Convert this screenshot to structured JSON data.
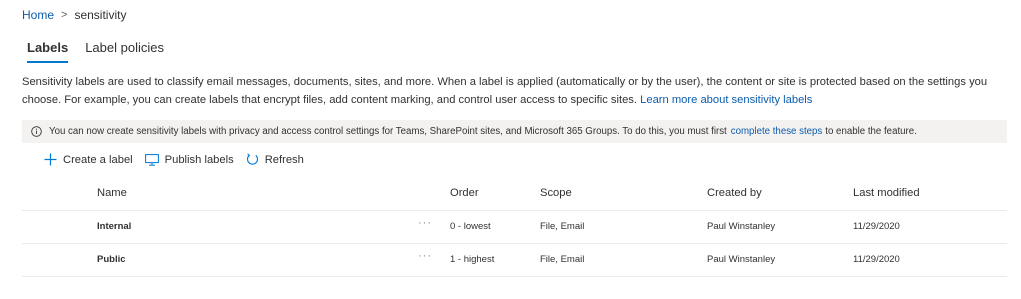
{
  "breadcrumb": {
    "home": "Home",
    "separator": ">",
    "current": "sensitivity"
  },
  "tabs": [
    {
      "label": "Labels",
      "active": true
    },
    {
      "label": "Label policies",
      "active": false
    }
  ],
  "description": {
    "text": "Sensitivity labels are used to classify email messages, documents, sites, and more. When a label is applied (automatically or by the user), the content or site is protected based on the settings you choose. For example, you can create labels that encrypt files, add content marking, and control user access to specific sites.",
    "link": "Learn more about sensitivity labels"
  },
  "info_bar": {
    "icon": "info-icon",
    "text": "You can now create sensitivity labels with privacy and access control settings for Teams, SharePoint sites, and Microsoft 365 Groups. To do this, you must first",
    "link": "complete these steps",
    "suffix": "to enable the feature."
  },
  "toolbar": {
    "create": {
      "label": "Create a label",
      "icon": "plus-icon"
    },
    "publish": {
      "label": "Publish labels",
      "icon": "monitor-icon"
    },
    "refresh": {
      "label": "Refresh",
      "icon": "refresh-icon"
    }
  },
  "table": {
    "columns": {
      "name": "Name",
      "order": "Order",
      "scope": "Scope",
      "created_by": "Created by",
      "last_modified": "Last modified"
    },
    "more_glyph": "···",
    "rows": [
      {
        "name": "Internal",
        "order": "0 - lowest",
        "scope": "File, Email",
        "created_by": "Paul Winstanley",
        "last_modified": "11/29/2020"
      },
      {
        "name": "Public",
        "order": "1 - highest",
        "scope": "File, Email",
        "created_by": "Paul Winstanley",
        "last_modified": "11/29/2020"
      }
    ]
  },
  "colors": {
    "accent": "#0078d4",
    "link": "#0b5cad",
    "info_bg": "#f3f2f1",
    "divider": "#edebe9"
  }
}
